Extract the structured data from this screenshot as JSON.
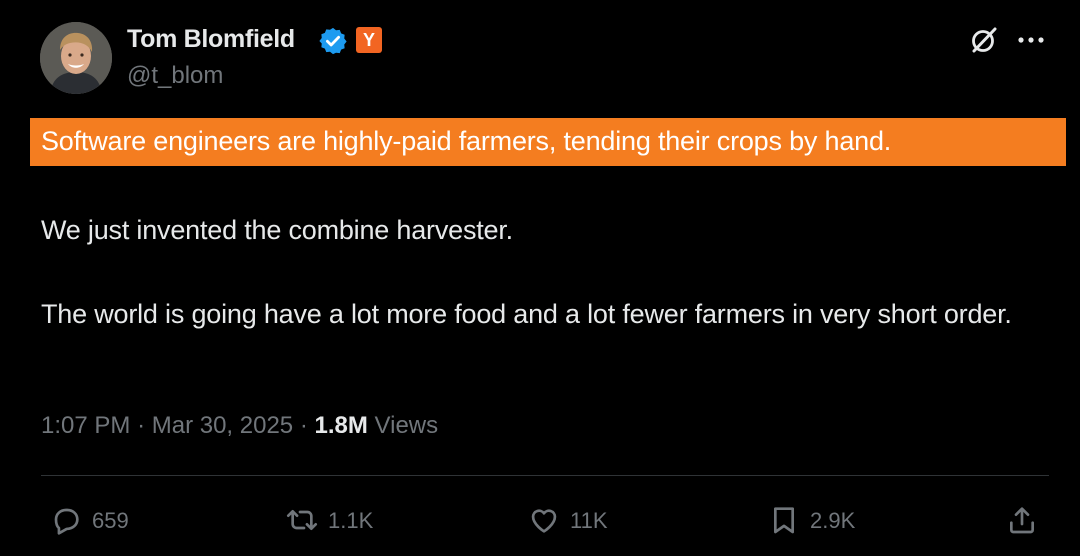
{
  "author": {
    "name": "Tom Blomfield",
    "handle": "@t_blom",
    "badge": "Y",
    "verified_color": "#1d9bf0",
    "badge_color": "#f26522"
  },
  "tweet": {
    "highlighted_text": "Software engineers are highly-paid farmers, tending their crops by hand.",
    "highlight_color": "#f47d20",
    "paragraphs": [
      "We just invented the combine harvester.",
      "The world is going have a lot more food and a lot fewer farmers in very short order."
    ]
  },
  "meta": {
    "time": "1:07 PM",
    "date": "Mar 30, 2025",
    "views_count": "1.8M",
    "views_label": "Views",
    "separator": "·"
  },
  "actions": {
    "replies": "659",
    "reposts": "1.1K",
    "likes": "11K",
    "bookmarks": "2.9K"
  },
  "icons": [
    "verified-icon",
    "grok-icon",
    "more-icon",
    "reply-icon",
    "retweet-icon",
    "like-icon",
    "bookmark-icon",
    "share-icon"
  ]
}
